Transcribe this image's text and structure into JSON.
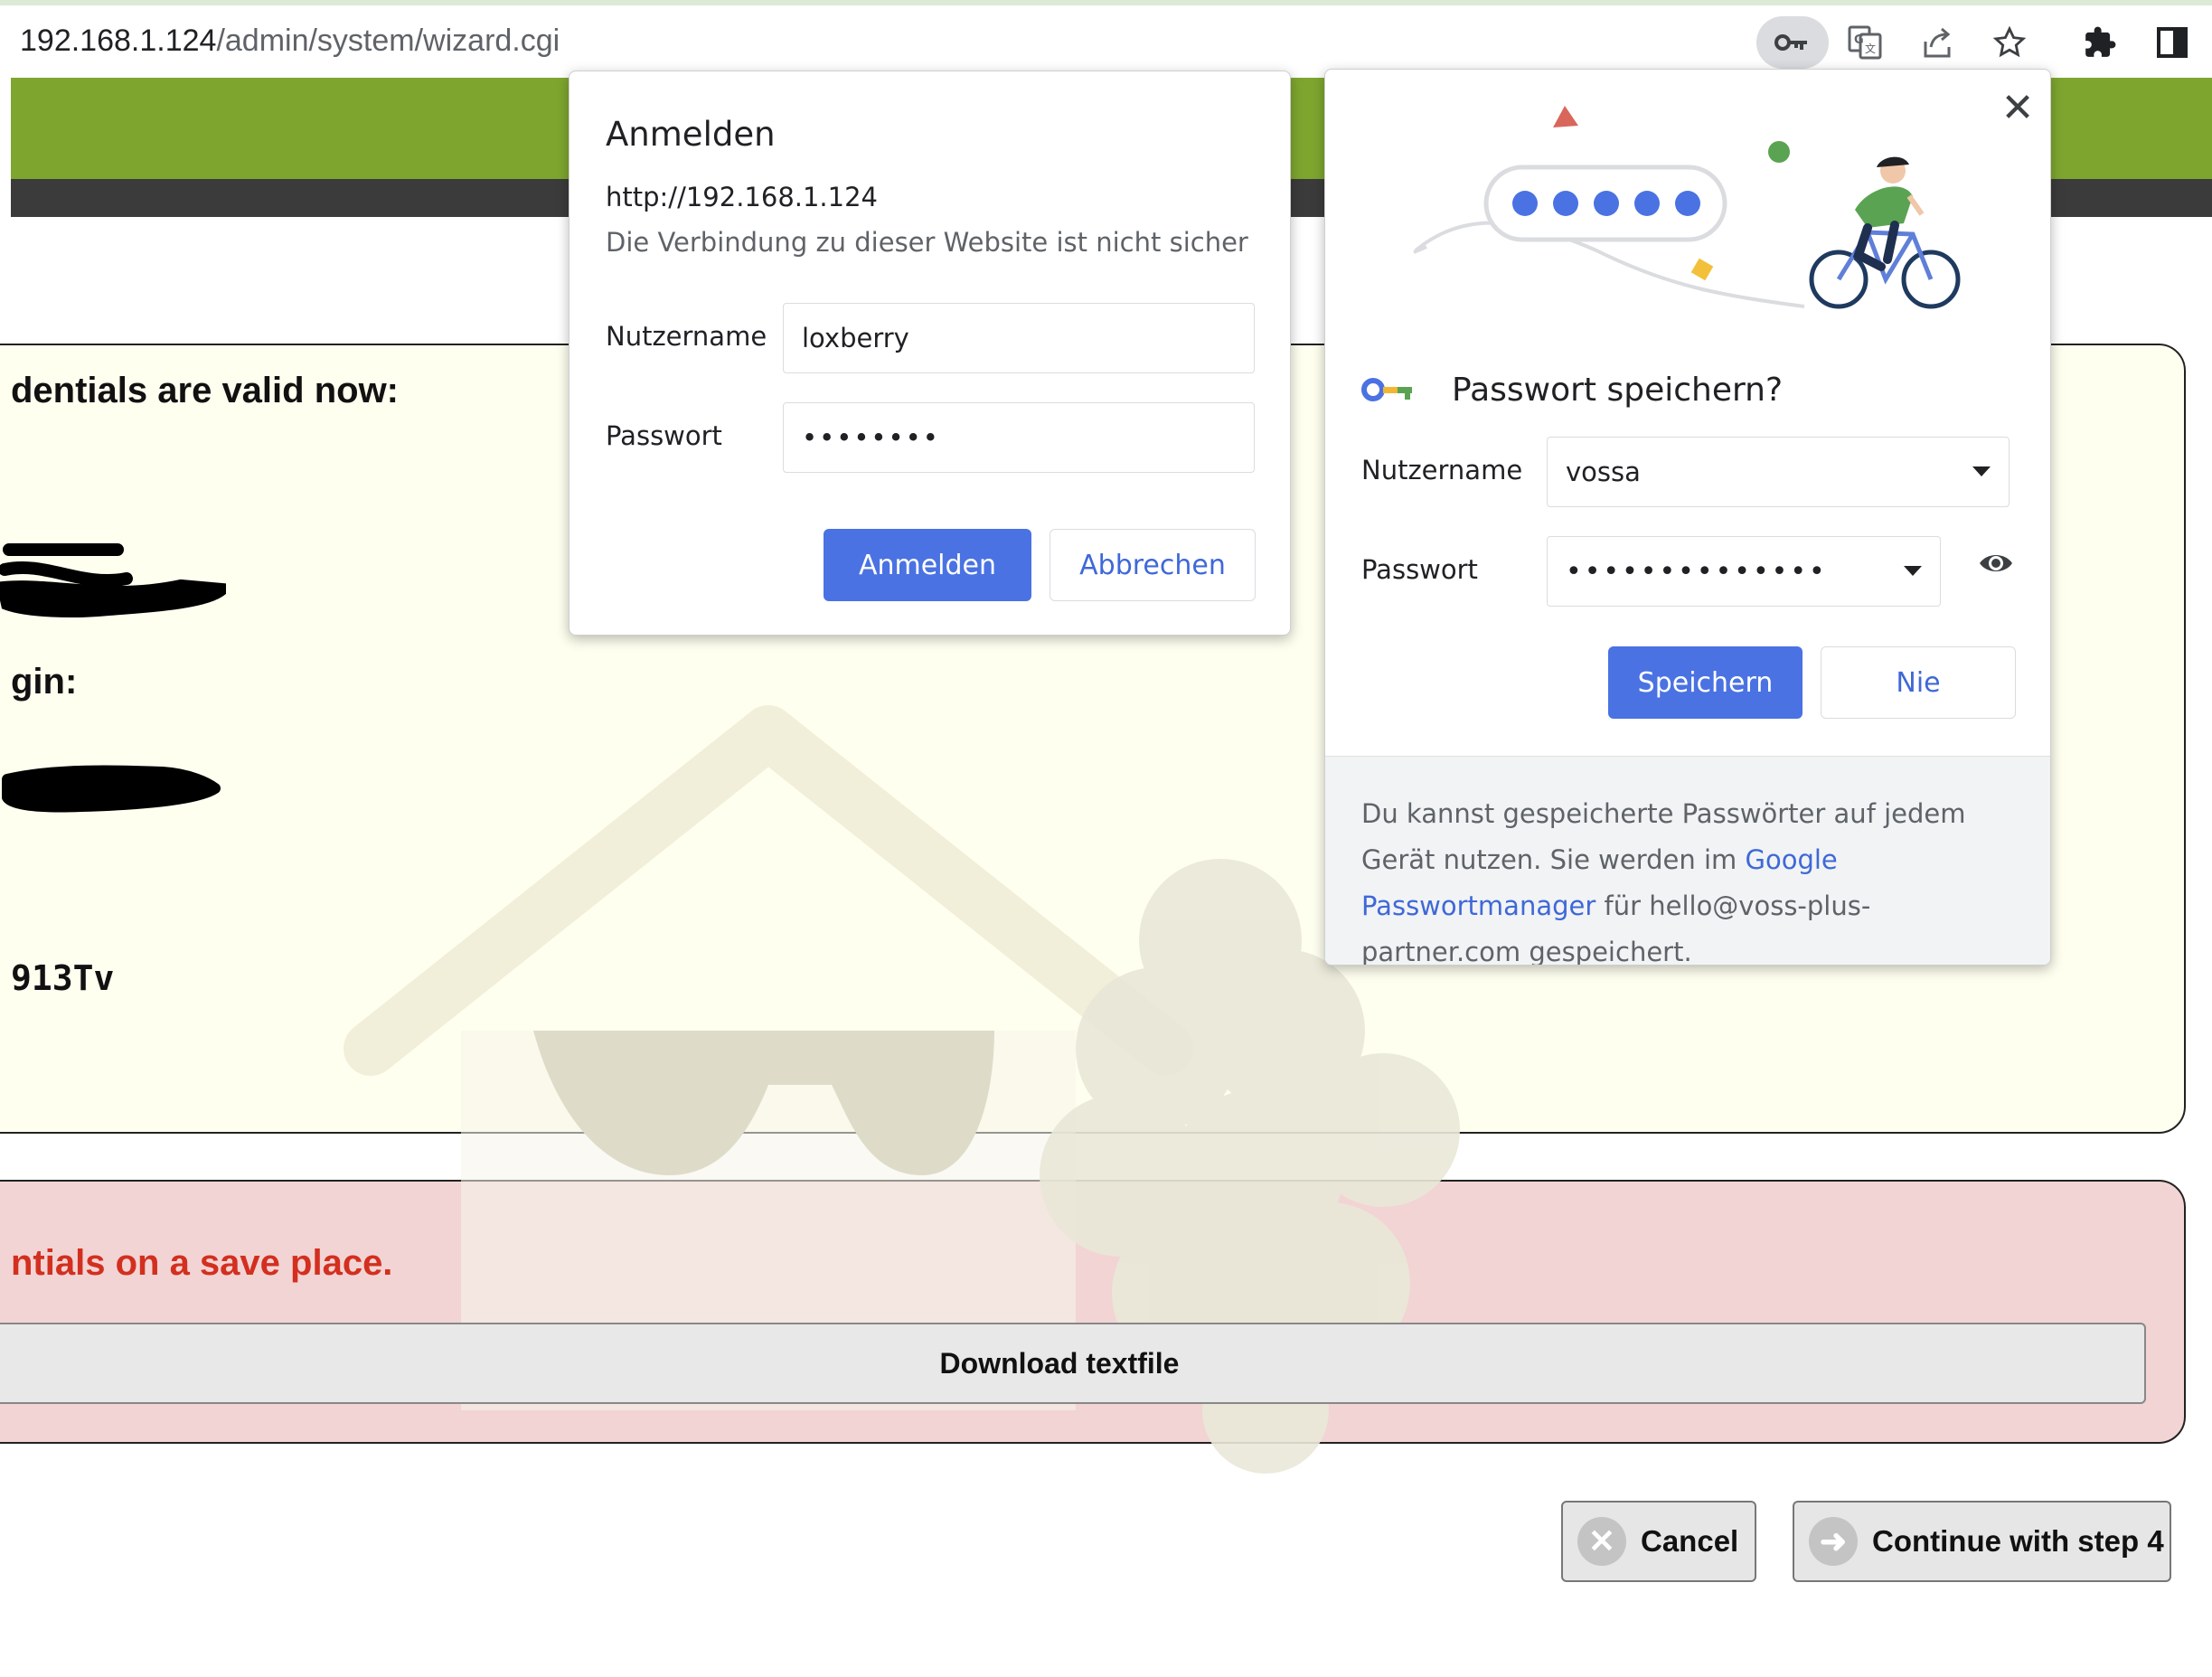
{
  "browser": {
    "url_host": "192.168.1.124",
    "url_path": "/admin/system/wizard.cgi",
    "toolbar_icons": [
      "key-icon",
      "translate-icon",
      "share-icon",
      "bookmark-star-icon",
      "extensions-puzzle-icon",
      "side-panel-icon"
    ]
  },
  "page": {
    "credentials_heading": "dentials are valid now:",
    "login_heading": "gin:",
    "code_value": "913Tv",
    "warning_text": "ntials on a save place.",
    "download_label": "Download textfile",
    "cancel_label": "Cancel",
    "continue_label": "Continue with step 4",
    "colors": {
      "header_green": "#7ea62f",
      "header_dark": "#3b3b3b",
      "info_panel": "#fffff0",
      "warning_panel": "#f2d4d4",
      "warning_text": "#d32f1f"
    }
  },
  "auth_dialog": {
    "title": "Anmelden",
    "origin": "http://192.168.1.124",
    "warning": "Die Verbindung zu dieser Website ist nicht sicher",
    "username_label": "Nutzername",
    "username_value": "loxberry",
    "password_label": "Passwort",
    "password_value": "••••••••",
    "submit_label": "Anmelden",
    "cancel_label": "Abbrechen",
    "accent": "#4a72e2"
  },
  "save_password": {
    "title": "Passwort speichern?",
    "username_label": "Nutzername",
    "username_value": "vossa",
    "password_label": "Passwort",
    "password_value": "••••••••••••••",
    "save_label": "Speichern",
    "never_label": "Nie",
    "footer_before": "Du kannst gespeicherte Passwörter auf jedem Gerät nutzen. Sie werden im ",
    "footer_link": "Google Passwortmanager",
    "footer_after": " für hello@voss-plus-partner.com gespeichert."
  }
}
